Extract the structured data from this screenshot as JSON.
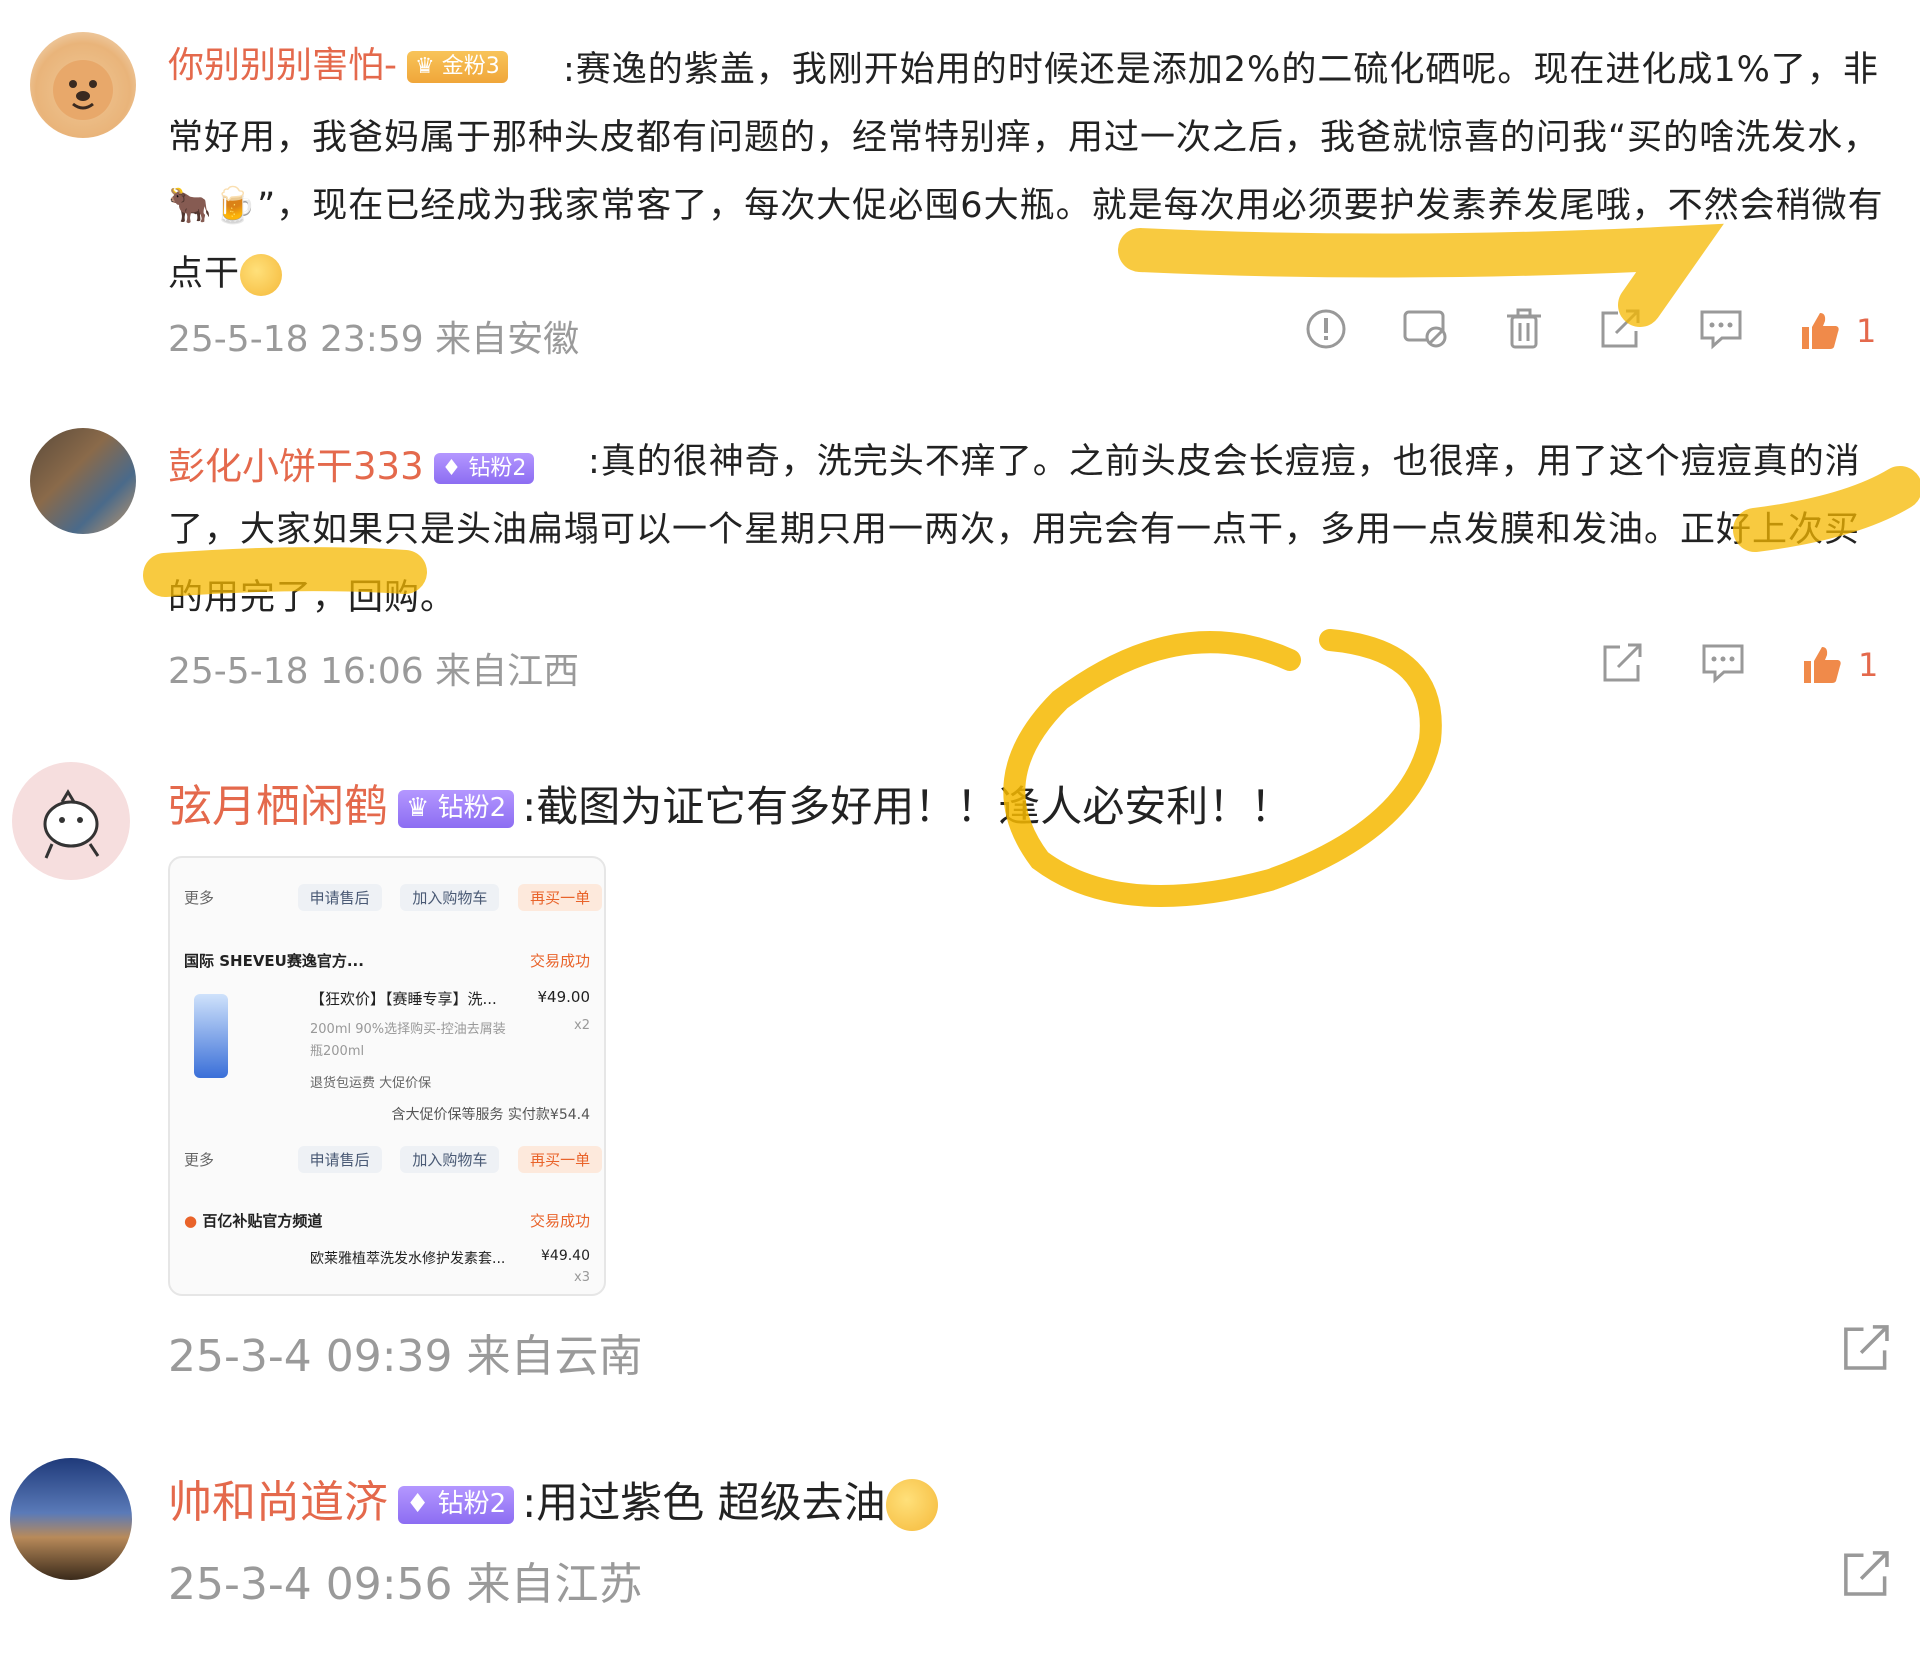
{
  "comments": [
    {
      "username": "你别别别害怕-",
      "badge": "金粉3",
      "text": ":赛逸的紫盖，我刚开始用的时候还是添加2%的二硫化硒呢。现在进化成1%了，非常好用，我爸妈属于那种头皮都有问题的，经常特别痒，用过一次之后，我爸就惊喜的问我“买的啥洗发水，",
      "emoji_inline": "🐂🍺",
      "text2": "”，现在已经成为我家常客了，每次大促必囤6大瓶。就是每次用必须要护发素养发尾哦，不然会稍微有点干",
      "meta": "25-5-18 23:59 来自安徽",
      "likes": "1"
    },
    {
      "username": "彭化小饼干333",
      "badge": "钻粉2",
      "text": ":真的很神奇，洗完头不痒了。之前头皮会长痘痘，也很痒，用了这个痘痘真的消了，大家如果只是头油扁塌可以一个星期只用一两次，用完会有一点干，多用一点发膜和发油。正好上次买的用完了，回购。",
      "meta": "25-5-18 16:06 来自江西",
      "likes": "1"
    },
    {
      "username": "弦月栖闲鹤",
      "badge": "钻粉2",
      "text": ":截图为证它有多好用！！逢人必安利！！",
      "meta": "25-3-4 09:39 来自云南"
    },
    {
      "username": "帅和尚道济",
      "badge": "钻粉2",
      "text": ":用过紫色 超级去油",
      "meta": "25-3-4 09:56 来自江苏"
    }
  ],
  "order_thumb": {
    "more_label": "更多",
    "btn_after_sale": "申请售后",
    "btn_add_cart": "加入购物车",
    "btn_buy_again": "再买一单",
    "store1": "国际 SHEVEU赛逸官方...",
    "status1": "交易成功",
    "item1_title": "【狂欢价】【赛睡专享】洗...",
    "item1_price": "¥49.00",
    "item1_qty": "x2",
    "item1_spec": "200ml 90%选择购买-控油去屑装",
    "item1_spec2": "瓶200ml",
    "item1_tags": "退货包运费  大促价保",
    "item1_paid": "含大促价保等服务 实付款¥54.4",
    "store2": "百亿补贴官方频道",
    "status2": "交易成功",
    "item2_title": "欧莱雅植萃洗发水修护发素套...",
    "item2_price": "¥49.40",
    "item2_qty": "x3"
  },
  "colors": {
    "username": "#e4694c",
    "highlight": "#f6b800",
    "meta": "#9a9a9a"
  },
  "icons": [
    "report-icon",
    "block-icon",
    "delete-icon",
    "share-icon",
    "comment-icon",
    "like-icon"
  ]
}
